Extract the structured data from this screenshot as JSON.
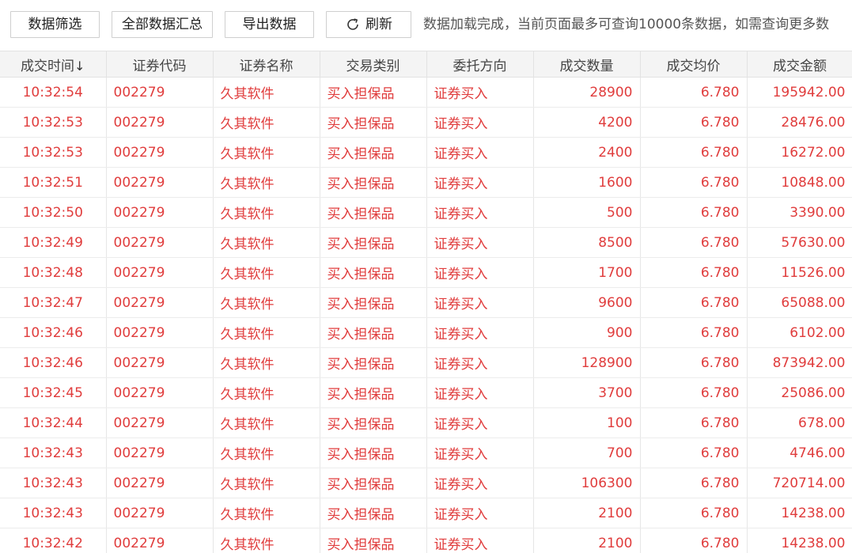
{
  "toolbar": {
    "filter_label": "数据筛选",
    "summary_label": "全部数据汇总",
    "export_label": "导出数据",
    "refresh_label": "刷新",
    "refresh_icon": "refresh-icon",
    "status_text": "数据加载完成，当前页面最多可查询10000条数据，如需查询更多数"
  },
  "table": {
    "headers": [
      "成交时间",
      "证券代码",
      "证券名称",
      "交易类别",
      "委托方向",
      "成交数量",
      "成交均价",
      "成交金额"
    ],
    "sort_indicator": "↓",
    "rows": [
      [
        "10:32:54",
        "002279",
        "久其软件",
        "买入担保品",
        "证券买入",
        "28900",
        "6.780",
        "195942.00"
      ],
      [
        "10:32:53",
        "002279",
        "久其软件",
        "买入担保品",
        "证券买入",
        "4200",
        "6.780",
        "28476.00"
      ],
      [
        "10:32:53",
        "002279",
        "久其软件",
        "买入担保品",
        "证券买入",
        "2400",
        "6.780",
        "16272.00"
      ],
      [
        "10:32:51",
        "002279",
        "久其软件",
        "买入担保品",
        "证券买入",
        "1600",
        "6.780",
        "10848.00"
      ],
      [
        "10:32:50",
        "002279",
        "久其软件",
        "买入担保品",
        "证券买入",
        "500",
        "6.780",
        "3390.00"
      ],
      [
        "10:32:49",
        "002279",
        "久其软件",
        "买入担保品",
        "证券买入",
        "8500",
        "6.780",
        "57630.00"
      ],
      [
        "10:32:48",
        "002279",
        "久其软件",
        "买入担保品",
        "证券买入",
        "1700",
        "6.780",
        "11526.00"
      ],
      [
        "10:32:47",
        "002279",
        "久其软件",
        "买入担保品",
        "证券买入",
        "9600",
        "6.780",
        "65088.00"
      ],
      [
        "10:32:46",
        "002279",
        "久其软件",
        "买入担保品",
        "证券买入",
        "900",
        "6.780",
        "6102.00"
      ],
      [
        "10:32:46",
        "002279",
        "久其软件",
        "买入担保品",
        "证券买入",
        "128900",
        "6.780",
        "873942.00"
      ],
      [
        "10:32:45",
        "002279",
        "久其软件",
        "买入担保品",
        "证券买入",
        "3700",
        "6.780",
        "25086.00"
      ],
      [
        "10:32:44",
        "002279",
        "久其软件",
        "买入担保品",
        "证券买入",
        "100",
        "6.780",
        "678.00"
      ],
      [
        "10:32:43",
        "002279",
        "久其软件",
        "买入担保品",
        "证券买入",
        "700",
        "6.780",
        "4746.00"
      ],
      [
        "10:32:43",
        "002279",
        "久其软件",
        "买入担保品",
        "证券买入",
        "106300",
        "6.780",
        "720714.00"
      ],
      [
        "10:32:43",
        "002279",
        "久其软件",
        "买入担保品",
        "证券买入",
        "2100",
        "6.780",
        "14238.00"
      ],
      [
        "10:32:42",
        "002279",
        "久其软件",
        "买入担保品",
        "证券买入",
        "2100",
        "6.780",
        "14238.00"
      ]
    ]
  },
  "colors": {
    "cell_text": "#e03c3c",
    "header_bg": "#f4f4f4",
    "border": "#e2e2e2"
  }
}
